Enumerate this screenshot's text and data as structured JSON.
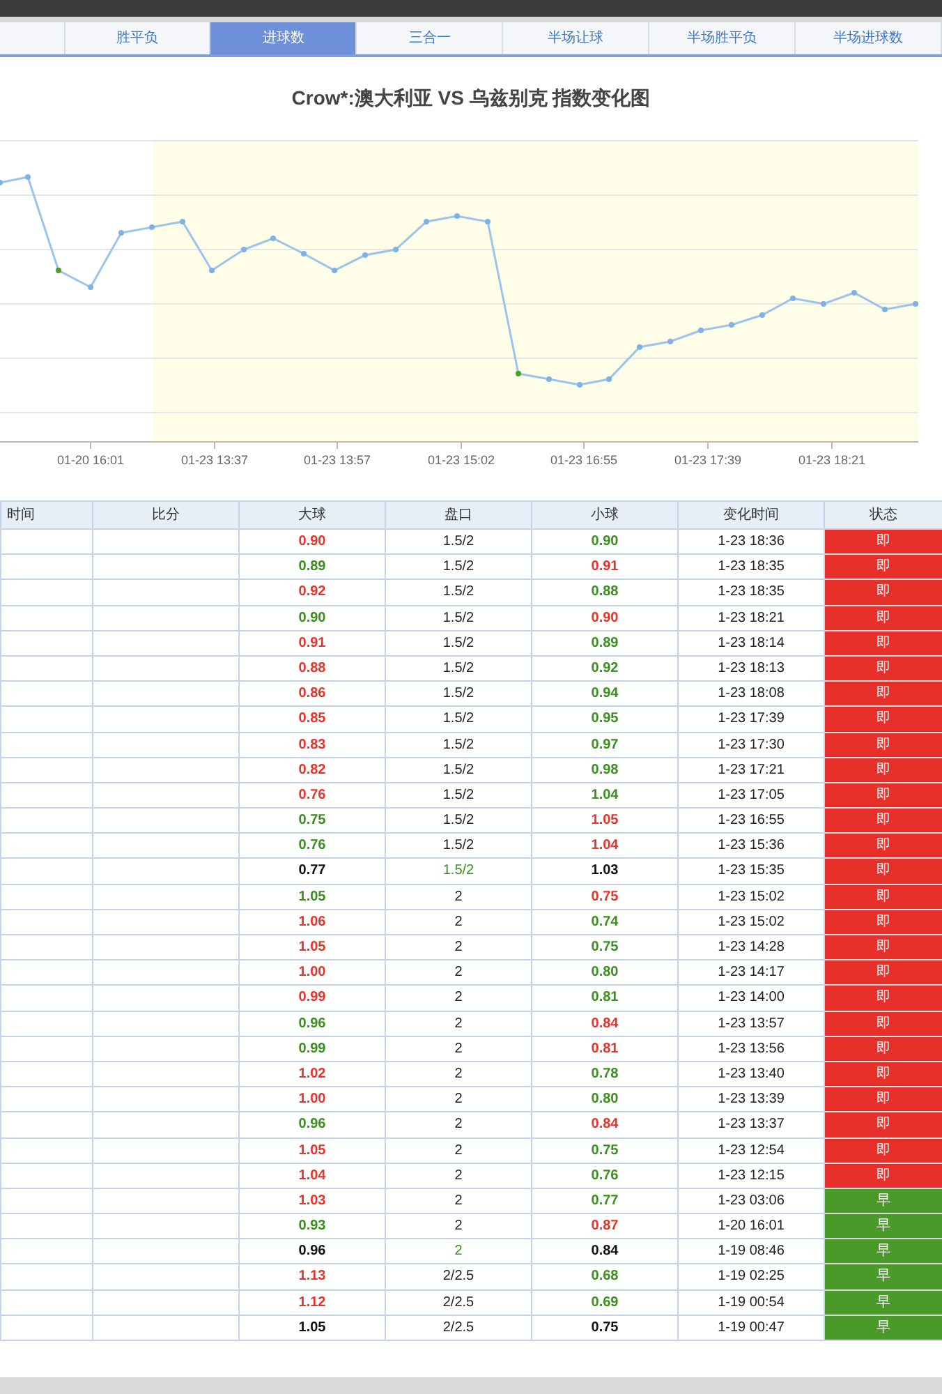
{
  "tabs": [
    {
      "label": "胜平负",
      "selected": false
    },
    {
      "label": "进球数",
      "selected": true
    },
    {
      "label": "三合一",
      "selected": false
    },
    {
      "label": "半场让球",
      "selected": false
    },
    {
      "label": "半场胜平负",
      "selected": false
    },
    {
      "label": "半场进球数",
      "selected": false
    }
  ],
  "chart": {
    "title": "Crow*:澳大利亚 VS 乌兹别克 指数变化图",
    "x_labels": [
      "01-20 16:01",
      "01-23 13:37",
      "01-23 13:57",
      "01-23 15:02",
      "01-23 16:55",
      "01-23 17:39",
      "01-23 18:21"
    ]
  },
  "table": {
    "columns": [
      "时间",
      "比分",
      "大球",
      "盘口",
      "小球",
      "变化时间",
      "状态"
    ],
    "rows": [
      {
        "over": {
          "text": "0.90",
          "kind": "up"
        },
        "line": {
          "text": "1.5/2",
          "changed": false
        },
        "under": {
          "text": "0.90",
          "kind": "down"
        },
        "time": "1-23 18:36",
        "status": {
          "text": "即",
          "kind": "live"
        }
      },
      {
        "over": {
          "text": "0.89",
          "kind": "down"
        },
        "line": {
          "text": "1.5/2",
          "changed": false
        },
        "under": {
          "text": "0.91",
          "kind": "up"
        },
        "time": "1-23 18:35",
        "status": {
          "text": "即",
          "kind": "live"
        }
      },
      {
        "over": {
          "text": "0.92",
          "kind": "up"
        },
        "line": {
          "text": "1.5/2",
          "changed": false
        },
        "under": {
          "text": "0.88",
          "kind": "down"
        },
        "time": "1-23 18:35",
        "status": {
          "text": "即",
          "kind": "live"
        }
      },
      {
        "over": {
          "text": "0.90",
          "kind": "down"
        },
        "line": {
          "text": "1.5/2",
          "changed": false
        },
        "under": {
          "text": "0.90",
          "kind": "up"
        },
        "time": "1-23 18:21",
        "status": {
          "text": "即",
          "kind": "live"
        }
      },
      {
        "over": {
          "text": "0.91",
          "kind": "up"
        },
        "line": {
          "text": "1.5/2",
          "changed": false
        },
        "under": {
          "text": "0.89",
          "kind": "down"
        },
        "time": "1-23 18:14",
        "status": {
          "text": "即",
          "kind": "live"
        }
      },
      {
        "over": {
          "text": "0.88",
          "kind": "up"
        },
        "line": {
          "text": "1.5/2",
          "changed": false
        },
        "under": {
          "text": "0.92",
          "kind": "down"
        },
        "time": "1-23 18:13",
        "status": {
          "text": "即",
          "kind": "live"
        }
      },
      {
        "over": {
          "text": "0.86",
          "kind": "up"
        },
        "line": {
          "text": "1.5/2",
          "changed": false
        },
        "under": {
          "text": "0.94",
          "kind": "down"
        },
        "time": "1-23 18:08",
        "status": {
          "text": "即",
          "kind": "live"
        }
      },
      {
        "over": {
          "text": "0.85",
          "kind": "up"
        },
        "line": {
          "text": "1.5/2",
          "changed": false
        },
        "under": {
          "text": "0.95",
          "kind": "down"
        },
        "time": "1-23 17:39",
        "status": {
          "text": "即",
          "kind": "live"
        }
      },
      {
        "over": {
          "text": "0.83",
          "kind": "up"
        },
        "line": {
          "text": "1.5/2",
          "changed": false
        },
        "under": {
          "text": "0.97",
          "kind": "down"
        },
        "time": "1-23 17:30",
        "status": {
          "text": "即",
          "kind": "live"
        }
      },
      {
        "over": {
          "text": "0.82",
          "kind": "up"
        },
        "line": {
          "text": "1.5/2",
          "changed": false
        },
        "under": {
          "text": "0.98",
          "kind": "down"
        },
        "time": "1-23 17:21",
        "status": {
          "text": "即",
          "kind": "live"
        }
      },
      {
        "over": {
          "text": "0.76",
          "kind": "up"
        },
        "line": {
          "text": "1.5/2",
          "changed": false
        },
        "under": {
          "text": "1.04",
          "kind": "down"
        },
        "time": "1-23 17:05",
        "status": {
          "text": "即",
          "kind": "live"
        }
      },
      {
        "over": {
          "text": "0.75",
          "kind": "down"
        },
        "line": {
          "text": "1.5/2",
          "changed": false
        },
        "under": {
          "text": "1.05",
          "kind": "up"
        },
        "time": "1-23 16:55",
        "status": {
          "text": "即",
          "kind": "live"
        }
      },
      {
        "over": {
          "text": "0.76",
          "kind": "down"
        },
        "line": {
          "text": "1.5/2",
          "changed": false
        },
        "under": {
          "text": "1.04",
          "kind": "up"
        },
        "time": "1-23 15:36",
        "status": {
          "text": "即",
          "kind": "live"
        }
      },
      {
        "over": {
          "text": "0.77",
          "kind": "same"
        },
        "line": {
          "text": "1.5/2",
          "changed": true
        },
        "under": {
          "text": "1.03",
          "kind": "same"
        },
        "time": "1-23 15:35",
        "status": {
          "text": "即",
          "kind": "live"
        }
      },
      {
        "over": {
          "text": "1.05",
          "kind": "down"
        },
        "line": {
          "text": "2",
          "changed": false
        },
        "under": {
          "text": "0.75",
          "kind": "up"
        },
        "time": "1-23 15:02",
        "status": {
          "text": "即",
          "kind": "live"
        }
      },
      {
        "over": {
          "text": "1.06",
          "kind": "up"
        },
        "line": {
          "text": "2",
          "changed": false
        },
        "under": {
          "text": "0.74",
          "kind": "down"
        },
        "time": "1-23 15:02",
        "status": {
          "text": "即",
          "kind": "live"
        }
      },
      {
        "over": {
          "text": "1.05",
          "kind": "up"
        },
        "line": {
          "text": "2",
          "changed": false
        },
        "under": {
          "text": "0.75",
          "kind": "down"
        },
        "time": "1-23 14:28",
        "status": {
          "text": "即",
          "kind": "live"
        }
      },
      {
        "over": {
          "text": "1.00",
          "kind": "up"
        },
        "line": {
          "text": "2",
          "changed": false
        },
        "under": {
          "text": "0.80",
          "kind": "down"
        },
        "time": "1-23 14:17",
        "status": {
          "text": "即",
          "kind": "live"
        }
      },
      {
        "over": {
          "text": "0.99",
          "kind": "up"
        },
        "line": {
          "text": "2",
          "changed": false
        },
        "under": {
          "text": "0.81",
          "kind": "down"
        },
        "time": "1-23 14:00",
        "status": {
          "text": "即",
          "kind": "live"
        }
      },
      {
        "over": {
          "text": "0.96",
          "kind": "down"
        },
        "line": {
          "text": "2",
          "changed": false
        },
        "under": {
          "text": "0.84",
          "kind": "up"
        },
        "time": "1-23 13:57",
        "status": {
          "text": "即",
          "kind": "live"
        }
      },
      {
        "over": {
          "text": "0.99",
          "kind": "down"
        },
        "line": {
          "text": "2",
          "changed": false
        },
        "under": {
          "text": "0.81",
          "kind": "up"
        },
        "time": "1-23 13:56",
        "status": {
          "text": "即",
          "kind": "live"
        }
      },
      {
        "over": {
          "text": "1.02",
          "kind": "up"
        },
        "line": {
          "text": "2",
          "changed": false
        },
        "under": {
          "text": "0.78",
          "kind": "down"
        },
        "time": "1-23 13:40",
        "status": {
          "text": "即",
          "kind": "live"
        }
      },
      {
        "over": {
          "text": "1.00",
          "kind": "up"
        },
        "line": {
          "text": "2",
          "changed": false
        },
        "under": {
          "text": "0.80",
          "kind": "down"
        },
        "time": "1-23 13:39",
        "status": {
          "text": "即",
          "kind": "live"
        }
      },
      {
        "over": {
          "text": "0.96",
          "kind": "down"
        },
        "line": {
          "text": "2",
          "changed": false
        },
        "under": {
          "text": "0.84",
          "kind": "up"
        },
        "time": "1-23 13:37",
        "status": {
          "text": "即",
          "kind": "live"
        }
      },
      {
        "over": {
          "text": "1.05",
          "kind": "up"
        },
        "line": {
          "text": "2",
          "changed": false
        },
        "under": {
          "text": "0.75",
          "kind": "down"
        },
        "time": "1-23 12:54",
        "status": {
          "text": "即",
          "kind": "live"
        }
      },
      {
        "over": {
          "text": "1.04",
          "kind": "up"
        },
        "line": {
          "text": "2",
          "changed": false
        },
        "under": {
          "text": "0.76",
          "kind": "down"
        },
        "time": "1-23 12:15",
        "status": {
          "text": "即",
          "kind": "live"
        }
      },
      {
        "over": {
          "text": "1.03",
          "kind": "up"
        },
        "line": {
          "text": "2",
          "changed": false
        },
        "under": {
          "text": "0.77",
          "kind": "down"
        },
        "time": "1-23 03:06",
        "status": {
          "text": "早",
          "kind": "early"
        }
      },
      {
        "over": {
          "text": "0.93",
          "kind": "down"
        },
        "line": {
          "text": "2",
          "changed": false
        },
        "under": {
          "text": "0.87",
          "kind": "up"
        },
        "time": "1-20 16:01",
        "status": {
          "text": "早",
          "kind": "early"
        }
      },
      {
        "over": {
          "text": "0.96",
          "kind": "same"
        },
        "line": {
          "text": "2",
          "changed": true
        },
        "under": {
          "text": "0.84",
          "kind": "same"
        },
        "time": "1-19 08:46",
        "status": {
          "text": "早",
          "kind": "early"
        }
      },
      {
        "over": {
          "text": "1.13",
          "kind": "up"
        },
        "line": {
          "text": "2/2.5",
          "changed": false
        },
        "under": {
          "text": "0.68",
          "kind": "down"
        },
        "time": "1-19 02:25",
        "status": {
          "text": "早",
          "kind": "early"
        }
      },
      {
        "over": {
          "text": "1.12",
          "kind": "up"
        },
        "line": {
          "text": "2/2.5",
          "changed": false
        },
        "under": {
          "text": "0.69",
          "kind": "down"
        },
        "time": "1-19 00:54",
        "status": {
          "text": "早",
          "kind": "early"
        }
      },
      {
        "over": {
          "text": "1.05",
          "kind": "same"
        },
        "line": {
          "text": "2/2.5",
          "changed": false
        },
        "under": {
          "text": "0.75",
          "kind": "same"
        },
        "time": "1-19 00:47",
        "status": {
          "text": "早",
          "kind": "early"
        }
      }
    ]
  }
}
